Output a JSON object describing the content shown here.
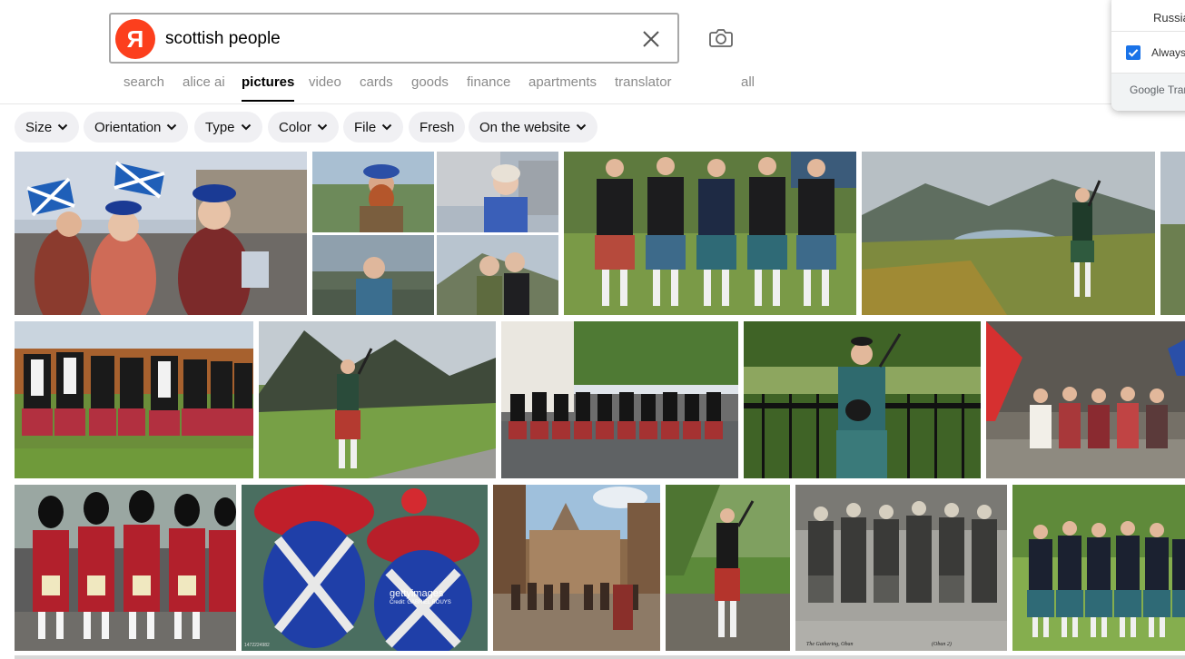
{
  "search": {
    "query": "scottish people",
    "logo_letter": "Я"
  },
  "tabs": [
    {
      "label": "search"
    },
    {
      "label": "alice ai"
    },
    {
      "label": "pictures",
      "active": true
    },
    {
      "label": "video"
    },
    {
      "label": "cards"
    },
    {
      "label": "goods"
    },
    {
      "label": "finance"
    },
    {
      "label": "apartments"
    },
    {
      "label": "translator"
    },
    {
      "label": "all"
    }
  ],
  "filters": [
    {
      "label": "Size",
      "dropdown": true
    },
    {
      "label": "Orientation",
      "dropdown": true
    },
    {
      "label": "Type",
      "dropdown": true
    },
    {
      "label": "Color",
      "dropdown": true
    },
    {
      "label": "File",
      "dropdown": true
    },
    {
      "label": "Fresh",
      "dropdown": false
    },
    {
      "label": "On the website",
      "dropdown": true
    }
  ],
  "translate_popup": {
    "language": "Russian",
    "always_label": "Always",
    "always_checked": true,
    "brand": "Google Translate"
  },
  "image_captions": {
    "getty_logo": "gettyimages",
    "getty_credit": "Credit: GABRIEL BOUYS",
    "getty_id": "1472224982",
    "archive_caption": "The Gathering, Oban",
    "archive_number": "(Oban 2)"
  },
  "colors": {
    "accent_logo": "#fc3f1d",
    "chip_bg": "#f0f0f3",
    "active_tab": "#000000",
    "inactive_tab": "#8a8a8a",
    "checkbox": "#1a73e8"
  }
}
